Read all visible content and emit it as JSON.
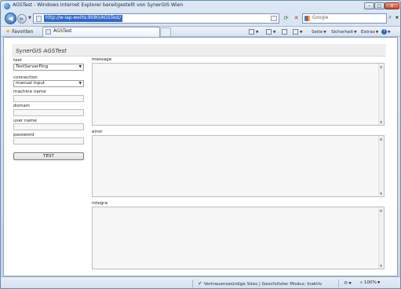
{
  "window": {
    "title": "AGSTest - Windows Internet Explorer bereitgestellt von SynerGIS Wien",
    "minimize": "–",
    "maximize": "□",
    "close": "x"
  },
  "addressbar": {
    "url": "http://w-lap-welhs:8080/AGSTest/",
    "back_glyph": "◀",
    "forward_glyph": "▶",
    "refresh_glyph": "⟳",
    "stop_glyph": "✕",
    "search_placeholder": "Google",
    "search_glyph": "⌕"
  },
  "favbar": {
    "favorites_label": "Favoriten",
    "tab_label": "AGSTest",
    "commands": {
      "page": "Seite",
      "safety": "Sicherheit",
      "tools": "Extras",
      "help": "?"
    }
  },
  "app": {
    "title": "SynerGIS AGSTest",
    "test_label": "test",
    "test_value": "TestServerPing",
    "connection_label": "connection",
    "connection_value": "manual input",
    "machine_name_label": "machine name",
    "domain_label": "domain",
    "user_name_label": "user name",
    "password_label": "password",
    "test_button": "TEST",
    "message_label": "message",
    "error_label": "error",
    "integra_label": "integra"
  },
  "statusbar": {
    "zone_text": "Vertrauenswürdige Sites | Geschützter Modus: Inaktiv",
    "zoom": "100%"
  },
  "icons": {
    "back": "back-arrow-icon",
    "forward": "forward-arrow-icon",
    "refresh": "refresh-icon",
    "stop": "stop-icon",
    "search": "search-icon",
    "favorites": "star-icon",
    "trusted": "checkmark-icon"
  },
  "colors": {
    "url_highlight": "#3169c6",
    "chrome": "#c9d6e6",
    "trusted_check": "#2c9a2c"
  }
}
